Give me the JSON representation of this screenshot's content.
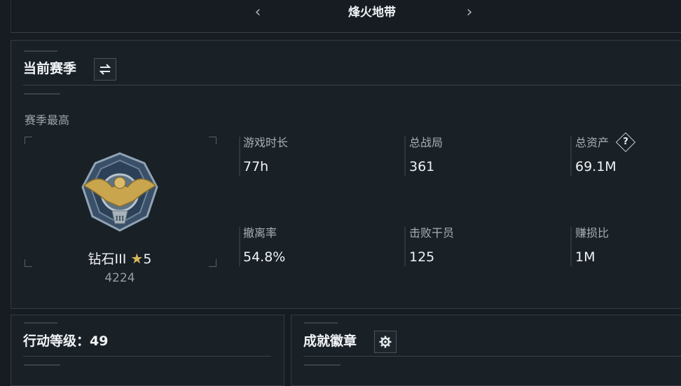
{
  "header": {
    "title": "烽火地带",
    "prev_icon": "chevron-left-icon",
    "next_icon": "chevron-right-icon"
  },
  "season": {
    "title": "当前赛季",
    "switch_icon": "swap-icon",
    "best_label": "赛季最高",
    "rank_name": "钻石III",
    "rank_stars": "5",
    "rank_score": "4224",
    "star_icon": "star-icon",
    "stats": [
      {
        "label": "游戏时长",
        "value": "77h"
      },
      {
        "label": "总战局",
        "value": "361"
      },
      {
        "label": "总资产",
        "value": "69.1M",
        "help": "?"
      },
      {
        "label": "撤离率",
        "value": "54.8%"
      },
      {
        "label": "击败干员",
        "value": "125"
      },
      {
        "label": "赚损比",
        "value": "1M"
      }
    ]
  },
  "level": {
    "title": "行动等级：49"
  },
  "badges": {
    "title": "成就徽章",
    "settings_icon": "gear-icon"
  },
  "colors": {
    "background": "#161c22",
    "panel": "#192026",
    "border": "#343b42",
    "text": "#f0f3f5",
    "muted": "#a7afb6"
  }
}
